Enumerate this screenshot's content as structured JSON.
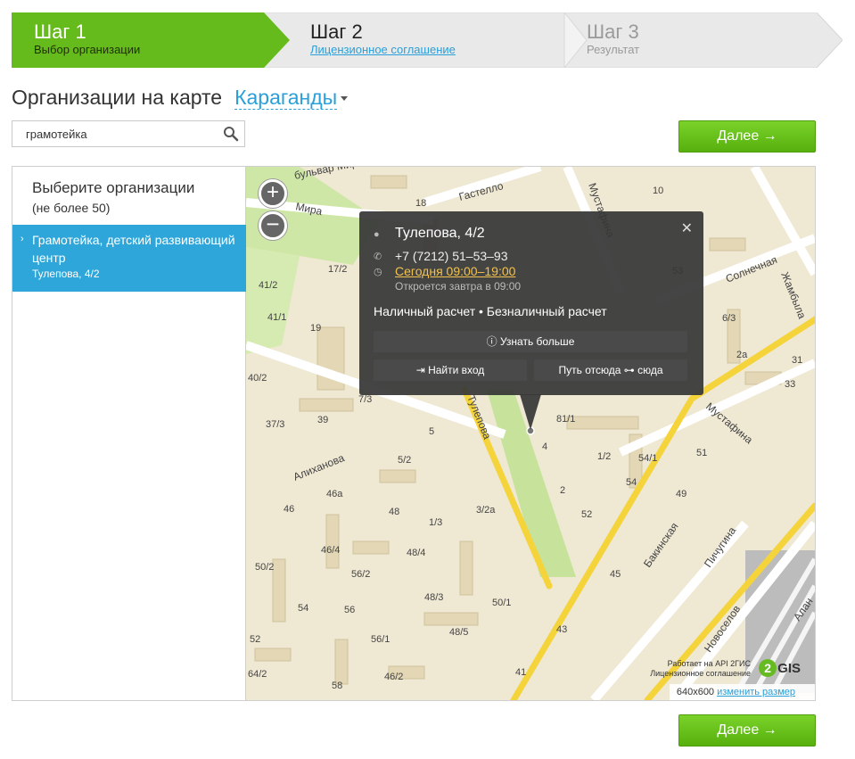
{
  "steps": [
    {
      "num": "Шаг 1",
      "label": "Выбор организации"
    },
    {
      "num": "Шаг 2",
      "label": "Лицензионное соглашение"
    },
    {
      "num": "Шаг 3",
      "label": "Результат"
    }
  ],
  "title": {
    "text": "Организации на карте",
    "city": "Караганды"
  },
  "search": {
    "value": "грамотейка"
  },
  "buttons": {
    "next": "Далее →"
  },
  "sidebar": {
    "heading": "Выберите организации",
    "limit": "(не более 50)",
    "org": {
      "name": "Грамотейка, детский развивающий центр",
      "address": "Тулепова, 4/2"
    }
  },
  "popup": {
    "name": "Тулепова, 4/2",
    "phone": "+7 (7212) 51–53–93",
    "hours": "Сегодня 09:00–19:00",
    "next_open": "Откроется завтра в 09:00",
    "payment": "Наличный расчет • Безналичный расчет",
    "more": "Узнать больше",
    "entry": "Найти вход",
    "route_from": "Путь отсюда",
    "route_to": "сюда"
  },
  "map": {
    "streets": [
      "бульвар Мира",
      "Мира",
      "Гастелло",
      "Мустафина",
      "Солнечная",
      "Жамбыла",
      "Тулепова",
      "Алиханова",
      "Мустафина",
      "Бакинская",
      "Пичугина",
      "Новоселов",
      "Алан"
    ],
    "buildings": [
      "18",
      "10",
      "17/2",
      "41/2",
      "41/1",
      "19",
      "40/2",
      "7/3",
      "37/3",
      "39",
      "5",
      "5/2",
      "46а",
      "46",
      "48",
      "1/3",
      "3/2а",
      "46/4",
      "48/4",
      "50/2",
      "56/2",
      "48/3",
      "54",
      "56",
      "50/1",
      "48/5",
      "52",
      "56/1",
      "41",
      "64/2",
      "58",
      "46/2",
      "43",
      "81/1",
      "4",
      "2",
      "52",
      "1/2",
      "54/1",
      "54",
      "49",
      "51",
      "45",
      "6/3",
      "2а",
      "31",
      "33",
      "53"
    ],
    "attribution": [
      "Работает на API 2ГИС",
      "Лицензионное соглашение"
    ],
    "logo": "GIS",
    "logo_num": "2",
    "size": "640x600",
    "resize": "изменить размер"
  },
  "colors": {
    "step_active": "#6cbf1d",
    "link": "#2a9fd8",
    "selected": "#2ea6d9",
    "button": "#62bd17",
    "hours": "#f3c24e"
  }
}
